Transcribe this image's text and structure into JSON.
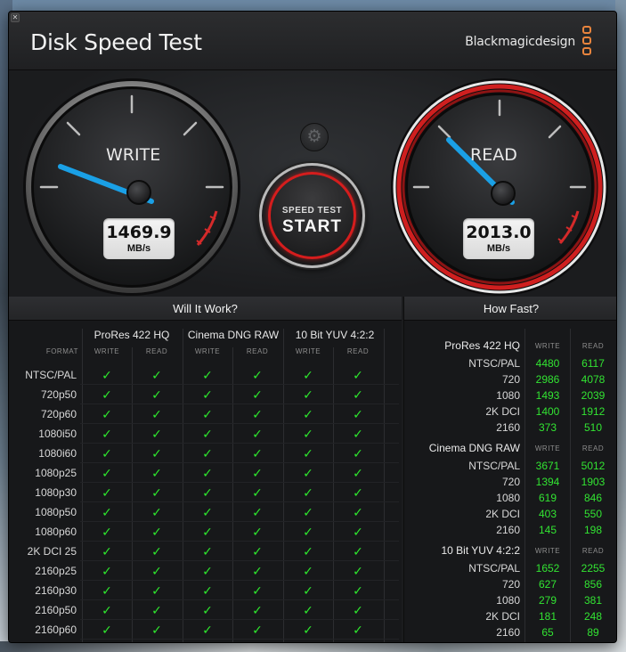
{
  "app": {
    "title": "Disk Speed Test",
    "brand": "Blackmagicdesign",
    "close_glyph": "✕",
    "brand_color": "#e8843d"
  },
  "write_gauge": {
    "label": "WRITE",
    "value": "1469.9",
    "unit": "MB/s"
  },
  "read_gauge": {
    "label": "READ",
    "value": "2013.0",
    "unit": "MB/s"
  },
  "start_button": {
    "line1": "SPEED TEST",
    "line2": "START"
  },
  "settings_icon": "gear-icon",
  "will_it_work": {
    "title": "Will It Work?",
    "format_label": "FORMAT",
    "write_label": "WRITE",
    "read_label": "READ",
    "groups": [
      "ProRes 422 HQ",
      "Cinema DNG RAW",
      "10 Bit YUV 4:2:2"
    ],
    "check": "✓",
    "check_color": "#2ee72e",
    "formats": [
      "NTSC/PAL",
      "720p50",
      "720p60",
      "1080i50",
      "1080i60",
      "1080p25",
      "1080p30",
      "1080p50",
      "1080p60",
      "2K DCI 25",
      "2160p25",
      "2160p30",
      "2160p50",
      "2160p60"
    ]
  },
  "how_fast": {
    "title": "How Fast?",
    "write_label": "WRITE",
    "read_label": "READ",
    "groups": [
      {
        "name": "ProRes 422 HQ",
        "rows": [
          {
            "format": "NTSC/PAL",
            "write": "4480",
            "read": "6117"
          },
          {
            "format": "720",
            "write": "2986",
            "read": "4078"
          },
          {
            "format": "1080",
            "write": "1493",
            "read": "2039"
          },
          {
            "format": "2K DCI",
            "write": "1400",
            "read": "1912"
          },
          {
            "format": "2160",
            "write": "373",
            "read": "510"
          }
        ]
      },
      {
        "name": "Cinema DNG RAW",
        "rows": [
          {
            "format": "NTSC/PAL",
            "write": "3671",
            "read": "5012"
          },
          {
            "format": "720",
            "write": "1394",
            "read": "1903"
          },
          {
            "format": "1080",
            "write": "619",
            "read": "846"
          },
          {
            "format": "2K DCI",
            "write": "403",
            "read": "550"
          },
          {
            "format": "2160",
            "write": "145",
            "read": "198"
          }
        ]
      },
      {
        "name": "10 Bit YUV 4:2:2",
        "rows": [
          {
            "format": "NTSC/PAL",
            "write": "1652",
            "read": "2255"
          },
          {
            "format": "720",
            "write": "627",
            "read": "856"
          },
          {
            "format": "1080",
            "write": "279",
            "read": "381"
          },
          {
            "format": "2K DCI",
            "write": "181",
            "read": "248"
          },
          {
            "format": "2160",
            "write": "65",
            "read": "89"
          }
        ]
      }
    ]
  }
}
